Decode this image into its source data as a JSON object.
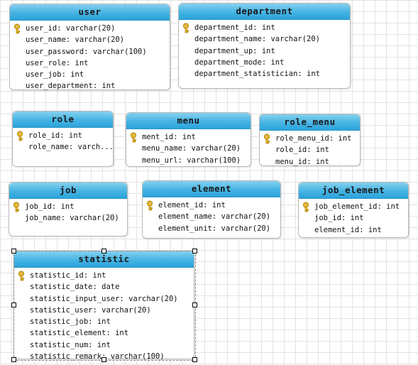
{
  "tables": {
    "user": {
      "name": "user",
      "fields": [
        {
          "text": "user_id: varchar(20)",
          "primary_key": true
        },
        {
          "text": "user_name: varchar(20)",
          "primary_key": false
        },
        {
          "text": "user_password: varchar(100)",
          "primary_key": false
        },
        {
          "text": "user_role: int",
          "primary_key": false
        },
        {
          "text": "user_job: int",
          "primary_key": false
        },
        {
          "text": "user_department: int",
          "primary_key": false
        }
      ]
    },
    "department": {
      "name": "department",
      "fields": [
        {
          "text": "department_id: int",
          "primary_key": true
        },
        {
          "text": "department_name: varchar(20)",
          "primary_key": false
        },
        {
          "text": "department_up: int",
          "primary_key": false
        },
        {
          "text": "department_mode: int",
          "primary_key": false
        },
        {
          "text": "department_statistician: int",
          "primary_key": false
        }
      ]
    },
    "role": {
      "name": "role",
      "fields": [
        {
          "text": "role_id: int",
          "primary_key": true
        },
        {
          "text": "role_name: varch...",
          "primary_key": false
        }
      ]
    },
    "menu": {
      "name": "menu",
      "fields": [
        {
          "text": "ment_id: int",
          "primary_key": true
        },
        {
          "text": "menu_name: varchar(20)",
          "primary_key": false
        },
        {
          "text": "menu_url: varchar(100)",
          "primary_key": false
        }
      ]
    },
    "role_menu": {
      "name": "role_menu",
      "fields": [
        {
          "text": "role_menu_id: int",
          "primary_key": true
        },
        {
          "text": "role_id: int",
          "primary_key": false
        },
        {
          "text": "menu_id: int",
          "primary_key": false
        }
      ]
    },
    "job": {
      "name": "job",
      "fields": [
        {
          "text": "job_id: int",
          "primary_key": true
        },
        {
          "text": "job_name: varchar(20)",
          "primary_key": false
        }
      ]
    },
    "element": {
      "name": "element",
      "fields": [
        {
          "text": "element_id: int",
          "primary_key": true
        },
        {
          "text": "element_name: varchar(20)",
          "primary_key": false
        },
        {
          "text": "element_unit: varchar(20)",
          "primary_key": false
        }
      ]
    },
    "job_element": {
      "name": "job_element",
      "fields": [
        {
          "text": "job_element_id: int",
          "primary_key": true
        },
        {
          "text": "job_id: int",
          "primary_key": false
        },
        {
          "text": "element_id: int",
          "primary_key": false
        }
      ]
    },
    "statistic": {
      "name": "statistic",
      "selected": true,
      "fields": [
        {
          "text": "statistic_id: int",
          "primary_key": true
        },
        {
          "text": "statistic_date: date",
          "primary_key": false
        },
        {
          "text": "statistic_input_user: varchar(20)",
          "primary_key": false
        },
        {
          "text": "statistic_user: varchar(20)",
          "primary_key": false
        },
        {
          "text": "statistic_job: int",
          "primary_key": false
        },
        {
          "text": "statistic_element: int",
          "primary_key": false
        },
        {
          "text": "statistic_num: int",
          "primary_key": false
        },
        {
          "text": "statistic_remark: varchar(100)",
          "primary_key": false
        }
      ]
    }
  },
  "icons": {
    "primary_key": "key-icon"
  },
  "colors": {
    "header_top": "#86d0ee",
    "header_bottom": "#2aa3da",
    "grid": "#e3e3e3",
    "key": "#f2c12e"
  }
}
